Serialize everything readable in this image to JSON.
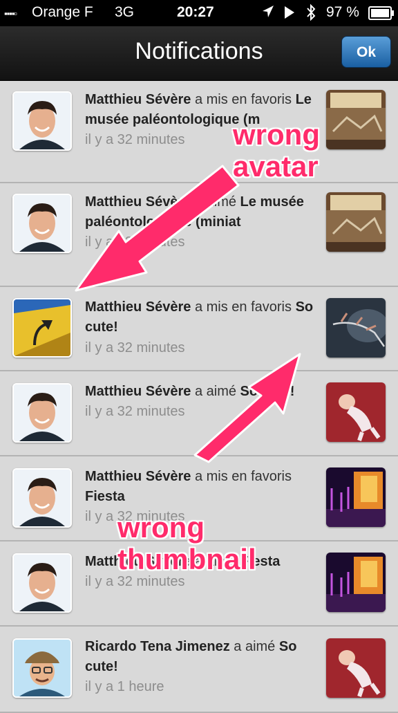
{
  "status_bar": {
    "signal": "▪▪▪▪▫",
    "carrier": "Orange F",
    "network": "3G",
    "time": "20:27",
    "battery_percent": "97 %"
  },
  "header": {
    "title": "Notifications",
    "ok_label": "Ok"
  },
  "notifications": [
    {
      "actor": "Matthieu Sévère",
      "action": "a mis en favoris",
      "item": "Le musée paléontologique (m",
      "time": "il y a 32 minutes",
      "avatar": "man-photo",
      "thumbnail": "museum-hall"
    },
    {
      "actor": "Matthieu Sévère",
      "action": "a aimé",
      "item": "Le musée paléontologique (miniat",
      "time": "il y a 32 minutes",
      "avatar": "man-photo",
      "thumbnail": "museum-hall"
    },
    {
      "actor": "Matthieu Sévère",
      "action": "a mis en favoris",
      "item": "So cute!",
      "time": "il y a 32 minutes",
      "avatar": "yellow-wall-lamp",
      "thumbnail": "frozen-branch"
    },
    {
      "actor": "Matthieu Sévère",
      "action": "a aimé",
      "item": "So cute!",
      "time": "il y a 32 minutes",
      "avatar": "man-photo",
      "thumbnail": "baby-photo"
    },
    {
      "actor": "Matthieu Sévère",
      "action": "a mis en favoris",
      "item": "Fiesta",
      "time": "il y a 32 minutes",
      "avatar": "man-photo",
      "thumbnail": "party-room"
    },
    {
      "actor": "Matthieu Sévère",
      "action": "a aimé",
      "item": "Fiesta",
      "time": "il y a 32 minutes",
      "avatar": "man-photo",
      "thumbnail": "party-room"
    },
    {
      "actor": "Ricardo Tena Jimenez",
      "action": "a aimé",
      "item": "So cute!",
      "time": "il y a 1 heure",
      "avatar": "cartoon-avatar",
      "thumbnail": "baby-photo"
    }
  ],
  "annotations": {
    "wrong_avatar": "wrong avatar",
    "wrong_thumbnail": "wrong thumbnail"
  },
  "colors": {
    "accent": "#ff2b6b",
    "ok_button": "#2a6fb3",
    "nav_bar": "#1e1e1e"
  }
}
